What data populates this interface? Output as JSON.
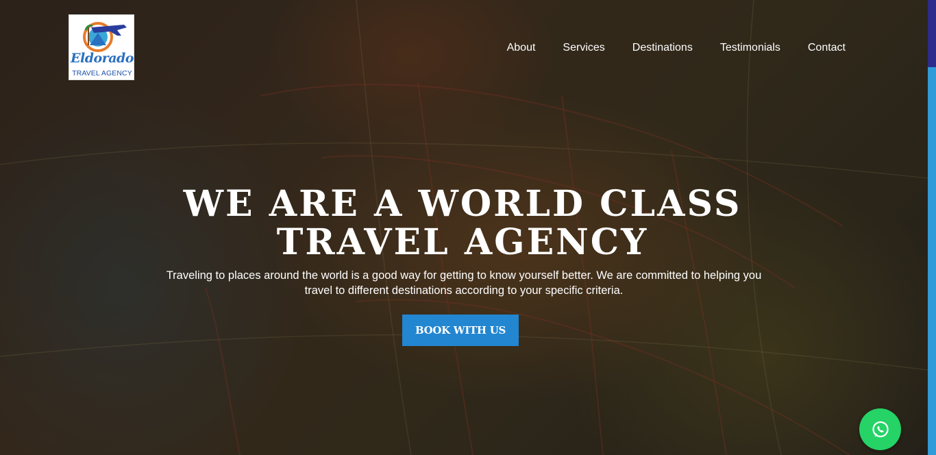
{
  "brand": {
    "logo_script": "Eldorado",
    "logo_sub": "TRAVEL AGENCY"
  },
  "nav": {
    "items": [
      {
        "label": "About"
      },
      {
        "label": "Services"
      },
      {
        "label": "Destinations"
      },
      {
        "label": "Testimonials"
      },
      {
        "label": "Contact"
      }
    ]
  },
  "hero": {
    "headline_line1": "WE ARE A WORLD CLASS",
    "headline_line2": "TRAVEL AGENCY",
    "tagline": "Traveling to places around the world is a good way for getting to know yourself better. We are committed to helping you travel to different destinations according to your specific criteria.",
    "cta_label": "BOOK WITH US"
  },
  "floating": {
    "whatsapp_icon": "whatsapp-icon"
  },
  "colors": {
    "accent": "#2386d1",
    "whatsapp": "#25d366",
    "scroll_track": "#2f9bd9",
    "scroll_thumb": "#2d2c8c"
  }
}
